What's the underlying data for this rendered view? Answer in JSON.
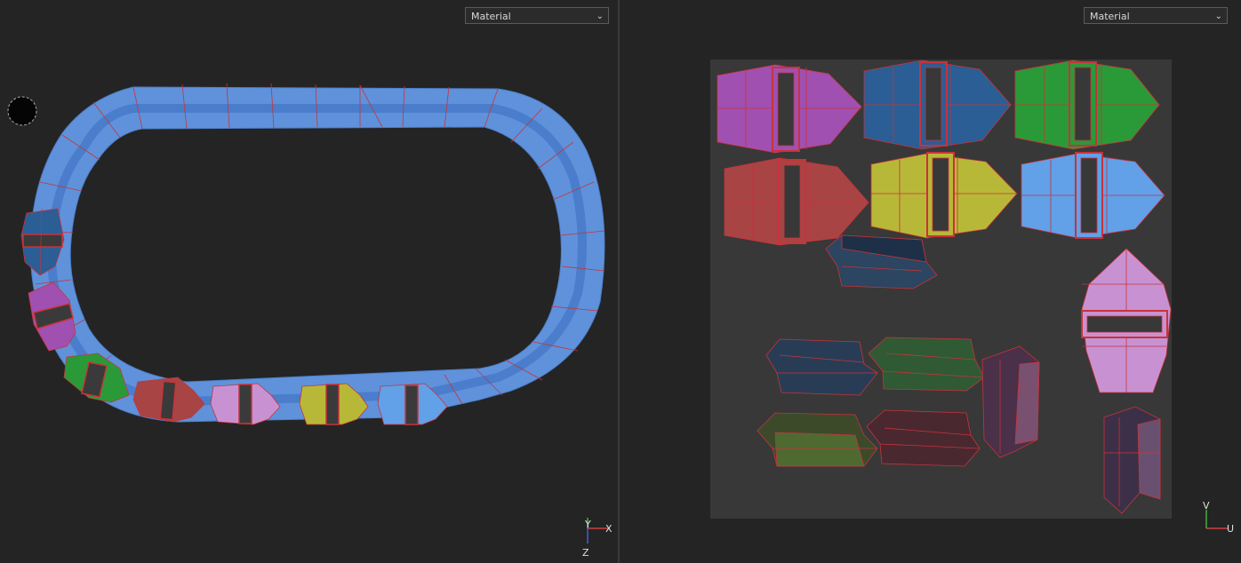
{
  "viewports": {
    "left": {
      "shading_mode": {
        "selected": "Material"
      },
      "gizmo": {
        "x": "X",
        "y": "Y",
        "z": "Z"
      }
    },
    "right": {
      "shading_mode": {
        "selected": "Material"
      },
      "gizmo": {
        "u": "U",
        "v": "V"
      }
    }
  },
  "colors": {
    "background": "#242424",
    "uv_tile": "#383838",
    "track": "#5f92db",
    "wire": "#c8333a",
    "magenta": "#a050b0",
    "blue": "#2a5e95",
    "green": "#2a9a38",
    "red": "#a84444",
    "yellow": "#b8b838",
    "light_blue": "#62a0e8",
    "pink": "#c892d2"
  }
}
